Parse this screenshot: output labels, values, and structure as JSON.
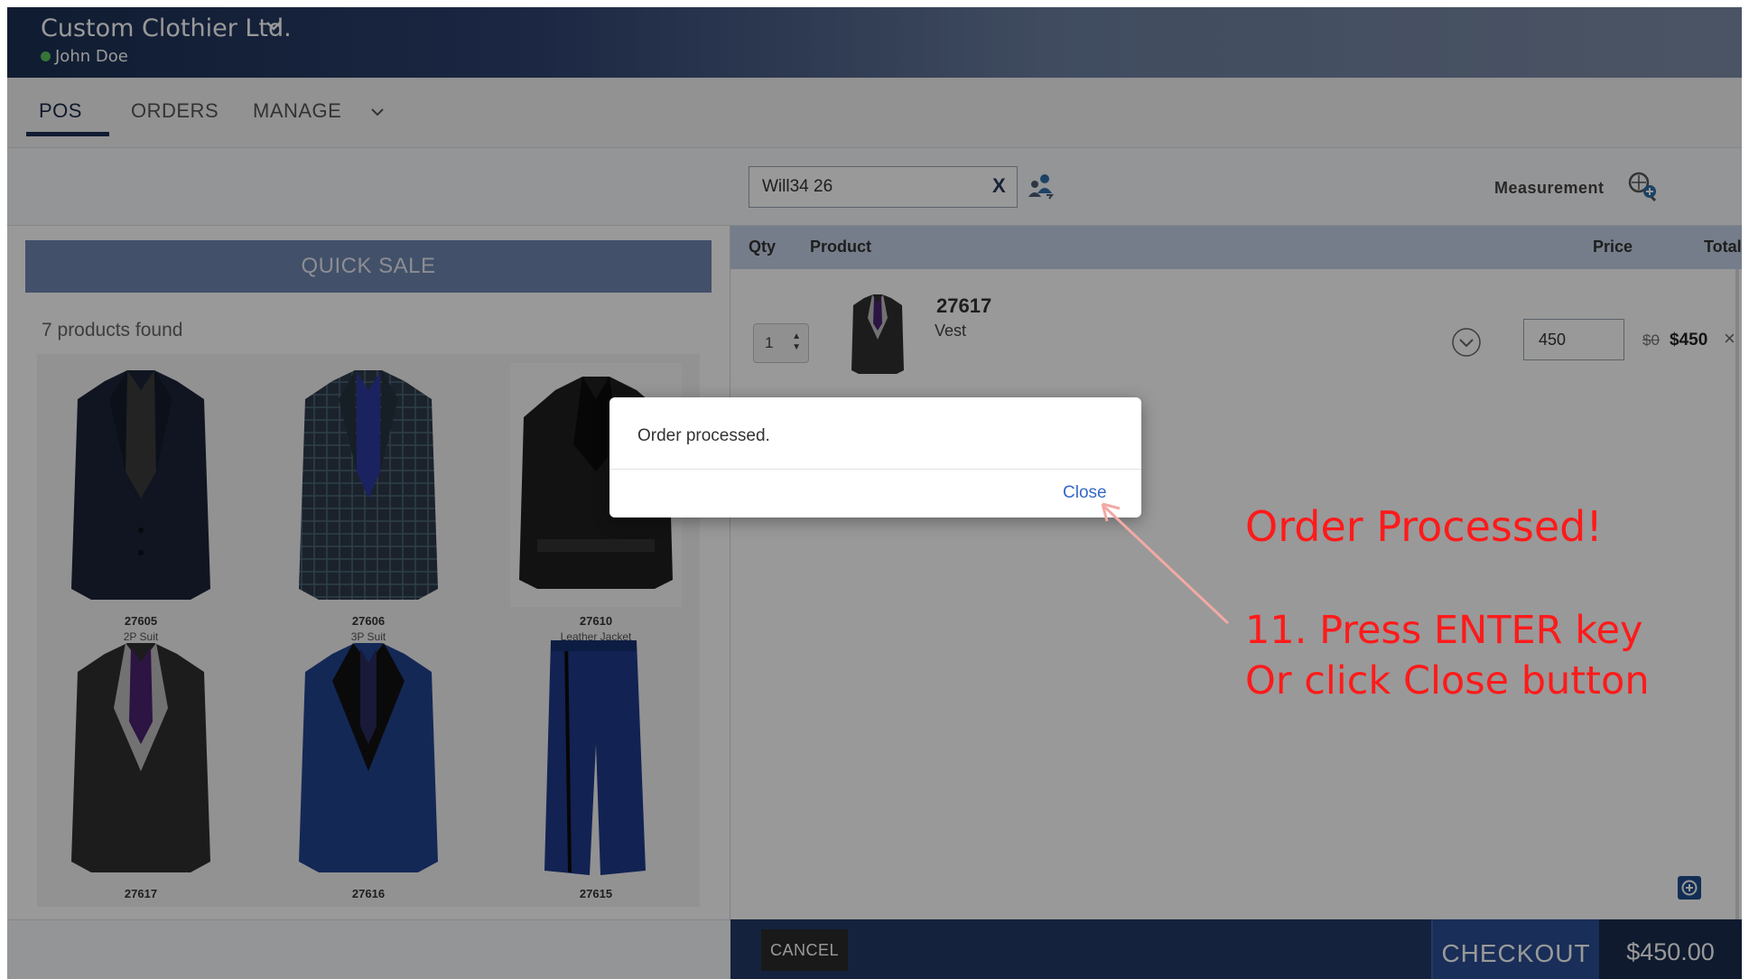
{
  "header": {
    "company": "Custom Clothier Ltd.",
    "user": "John Doe",
    "user_status_color": "#5cc15c"
  },
  "nav": {
    "tabs": [
      {
        "label": "POS",
        "active": true
      },
      {
        "label": "ORDERS",
        "active": false
      },
      {
        "label": "MANAGE",
        "active": false
      }
    ]
  },
  "left": {
    "quick_sale": "QUICK SALE",
    "found_text": "7 products found",
    "products": [
      {
        "code": "27605",
        "name": "2P Suit"
      },
      {
        "code": "27606",
        "name": "3P Suit"
      },
      {
        "code": "27610",
        "name": "Leather Jacket"
      },
      {
        "code": "27617",
        "name": ""
      },
      {
        "code": "27616",
        "name": ""
      },
      {
        "code": "27615",
        "name": ""
      }
    ]
  },
  "right": {
    "customer_value": "Will34 26",
    "clear": "X",
    "measurement": "Measurement",
    "columns": {
      "qty": "Qty",
      "product": "Product",
      "price": "Price",
      "total": "Total"
    },
    "item": {
      "qty": "1",
      "code": "27617",
      "name": "Vest",
      "price_value": "450",
      "old_price": "$0",
      "total": "$450",
      "remove": "×"
    },
    "cancel": "CANCEL",
    "checkout": "CHECKOUT",
    "checkout_total": "$450.00"
  },
  "dialog": {
    "message": "Order processed.",
    "close": "Close"
  },
  "annotation": {
    "title": "Order Processed!",
    "step_number": "11.",
    "step_line1": "Press ENTER key",
    "step_line2": "Or click Close button",
    "color": "#ff1a1a"
  },
  "icons": [
    "chevron-down-icon",
    "customer-switch-icon",
    "measurement-icon",
    "expand-toggle-icon",
    "add-item-icon"
  ]
}
